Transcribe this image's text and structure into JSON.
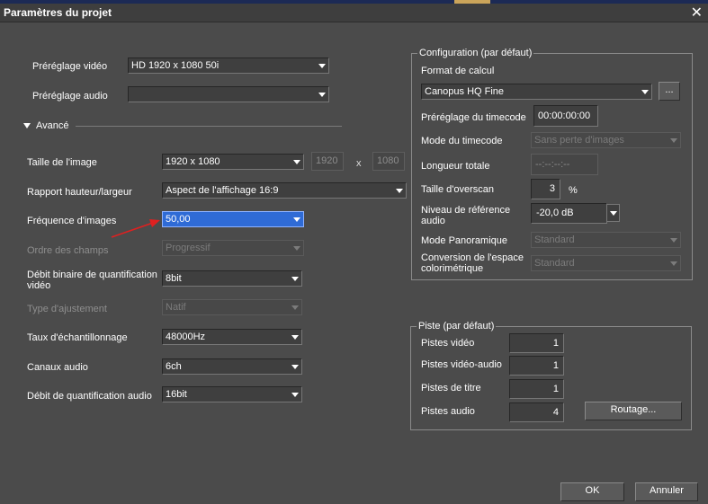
{
  "window": {
    "title": "Paramètres du projet"
  },
  "top": {
    "video_preset_label": "Préréglage vidéo",
    "video_preset_value": "HD 1920 x 1080 50i",
    "audio_preset_label": "Préréglage audio",
    "audio_preset_value": "",
    "advanced_label": "Avancé"
  },
  "advanced": {
    "image_size_label": "Taille de l'image",
    "image_size_value": "1920 x 1080",
    "width_value": "1920",
    "x_sep": "x",
    "height_value": "1080",
    "aspect_label": "Rapport hauteur/largeur",
    "aspect_value": "Aspect de l'affichage 16:9",
    "frame_rate_label": "Fréquence d'images",
    "frame_rate_value": "50,00",
    "field_order_label": "Ordre des champs",
    "field_order_value": "Progressif",
    "bitdepth_label": "Débit binaire de quantification vidéo",
    "bitdepth_value": "8bit",
    "fit_type_label": "Type d'ajustement",
    "fit_type_value": "Natif",
    "sample_rate_label": "Taux d'échantillonnage",
    "sample_rate_value": "48000Hz",
    "audio_channels_label": "Canaux audio",
    "audio_channels_value": "6ch",
    "audio_quant_label": "Débit de quantification audio",
    "audio_quant_value": "16bit"
  },
  "config": {
    "group_title": "Configuration (par défaut)",
    "render_format_label": "Format de calcul",
    "render_format_value": "Canopus HQ Fine",
    "browse_label": "...",
    "tc_preset_label": "Préréglage du timecode",
    "tc_preset_value": "00:00:00:00",
    "tc_mode_label": "Mode du timecode",
    "tc_mode_value": "Sans perte d'images",
    "total_length_label": "Longueur totale",
    "total_length_value": "--:--:--:--",
    "overscan_label": "Taille d'overscan",
    "overscan_value": "3",
    "overscan_unit": "%",
    "audio_ref_label": "Niveau de référence audio",
    "audio_ref_value": "-20,0 dB",
    "pan_mode_label": "Mode Panoramique",
    "pan_mode_value": "Standard",
    "colorspace_label": "Conversion de l'espace colorimétrique",
    "colorspace_value": "Standard"
  },
  "tracks": {
    "group_title": "Piste (par défaut)",
    "video_label": "Pistes vidéo",
    "video_value": "1",
    "va_label": "Pistes vidéo-audio",
    "va_value": "1",
    "title_label": "Pistes de titre",
    "title_value": "1",
    "audio_label": "Pistes audio",
    "audio_value": "4",
    "routing_label": "Routage..."
  },
  "footer": {
    "ok_label": "OK",
    "cancel_label": "Annuler"
  },
  "colors": {
    "background": "#4b4b4b",
    "highlight": "#2f6bd6",
    "annotation_arrow": "#e02020"
  }
}
